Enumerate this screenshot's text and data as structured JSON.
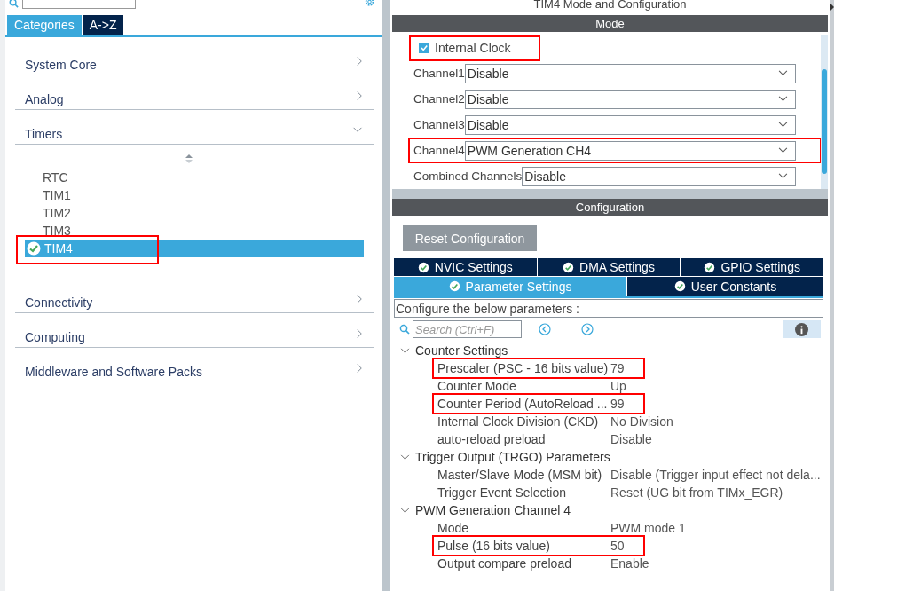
{
  "sidebar": {
    "tabs": [
      {
        "label": "Categories",
        "selected": true
      },
      {
        "label": "A->Z",
        "selected": false
      }
    ],
    "categories": [
      {
        "label": "System Core",
        "expanded": false
      },
      {
        "label": "Analog",
        "expanded": false
      },
      {
        "label": "Timers",
        "expanded": true,
        "children": [
          {
            "label": "RTC",
            "selected": false,
            "checked": false,
            "highlighted": false
          },
          {
            "label": "TIM1",
            "selected": false,
            "checked": false,
            "highlighted": false
          },
          {
            "label": "TIM2",
            "selected": false,
            "checked": false,
            "highlighted": false
          },
          {
            "label": "TIM3",
            "selected": false,
            "checked": false,
            "highlighted": false
          },
          {
            "label": "TIM4",
            "selected": true,
            "checked": true,
            "highlighted": true
          }
        ]
      },
      {
        "label": "Connectivity",
        "expanded": false
      },
      {
        "label": "Computing",
        "expanded": false
      },
      {
        "label": "Middleware and Software Packs",
        "expanded": false
      }
    ]
  },
  "panel": {
    "title": "TIM4 Mode and Configuration",
    "mode": {
      "header": "Mode",
      "internal_clock": {
        "label": "Internal Clock",
        "checked": true,
        "highlighted": true
      },
      "channels": [
        {
          "label": "Channel1",
          "value": "Disable",
          "highlighted": false
        },
        {
          "label": "Channel2",
          "value": "Disable",
          "highlighted": false
        },
        {
          "label": "Channel3",
          "value": "Disable",
          "highlighted": false
        },
        {
          "label": "Channel4",
          "value": "PWM Generation CH4",
          "highlighted": true
        },
        {
          "label": "Combined Channels",
          "value": "Disable",
          "highlighted": false
        }
      ]
    },
    "configuration": {
      "header": "Configuration",
      "reset_button": "Reset Configuration",
      "tab_rows": [
        [
          {
            "label": "NVIC Settings",
            "selected": false
          },
          {
            "label": "DMA Settings",
            "selected": false
          },
          {
            "label": "GPIO Settings",
            "selected": false
          }
        ],
        [
          {
            "label": "Parameter Settings",
            "selected": true
          },
          {
            "label": "User Constants",
            "selected": false
          }
        ]
      ],
      "description": "Configure the below parameters :",
      "search": {
        "placeholder": "Search (Ctrl+F)"
      },
      "parameters": [
        {
          "group": "Counter Settings",
          "expanded": true,
          "children": [
            {
              "name": "Prescaler (PSC - 16 bits value)",
              "value": "79",
              "highlighted": true
            },
            {
              "name": "Counter Mode",
              "value": "Up",
              "highlighted": false
            },
            {
              "name": "Counter Period (AutoReload ...",
              "value": "99",
              "highlighted": true
            },
            {
              "name": "Internal Clock Division (CKD)",
              "value": "No Division",
              "highlighted": false
            },
            {
              "name": "auto-reload preload",
              "value": "Disable",
              "highlighted": false
            }
          ]
        },
        {
          "group": "Trigger Output (TRGO) Parameters",
          "expanded": true,
          "children": [
            {
              "name": "Master/Slave Mode (MSM bit)",
              "value": "Disable (Trigger input effect not dela...",
              "highlighted": false
            },
            {
              "name": "Trigger Event Selection",
              "value": "Reset (UG bit from TIMx_EGR)",
              "highlighted": false
            }
          ]
        },
        {
          "group": "PWM Generation Channel 4",
          "expanded": true,
          "children": [
            {
              "name": "Mode",
              "value": "PWM mode 1",
              "highlighted": false
            },
            {
              "name": "Pulse (16 bits value)",
              "value": "50",
              "highlighted": true
            },
            {
              "name": "Output compare preload",
              "value": "Enable",
              "highlighted": false
            }
          ]
        }
      ]
    }
  }
}
